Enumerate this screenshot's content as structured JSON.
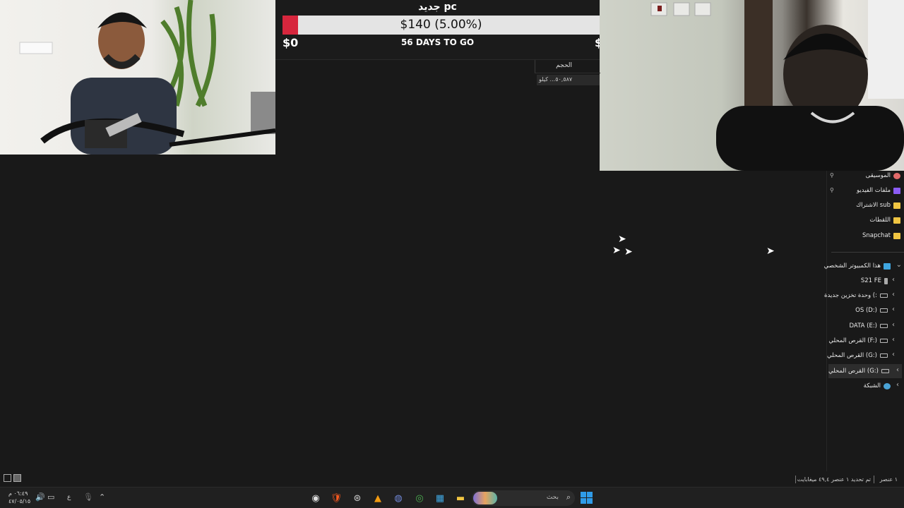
{
  "goal": {
    "title": "جديد pc",
    "amount_label": "$140 (5.00%)",
    "progress_percent": 5,
    "min_label": "$0",
    "days_label": "56 DAYS TO GO",
    "max_label": "$",
    "fill_color": "#d7263d"
  },
  "explorer": {
    "column_header": "الحجم",
    "size_cell": "٥٠,٥٨٧... كيلو",
    "nav": {
      "quick_access": [
        {
          "label": "الموسيقى",
          "icon": "music-icon"
        },
        {
          "label": "ملفات الفيديو",
          "icon": "video-icon"
        },
        {
          "label": "الاشتراك sub",
          "icon": "folder-icon"
        },
        {
          "label": "اللقطات",
          "icon": "folder-icon"
        },
        {
          "label": "Snapchat",
          "icon": "folder-icon"
        }
      ],
      "this_pc": "هذا الكمبيوتر الشخصي",
      "drives": [
        {
          "label": "S21 FE",
          "icon": "phone-icon"
        },
        {
          "label": "وحدة تخزين جديدة (:",
          "icon": "drive-icon"
        },
        {
          "label": "OS (D:)",
          "icon": "drive-icon"
        },
        {
          "label": "DATA (E:)",
          "icon": "drive-icon"
        },
        {
          "label": "القرص المحلي (F:)",
          "icon": "drive-icon"
        },
        {
          "label": "القرص المحلي (G:)",
          "icon": "drive-icon"
        },
        {
          "label": "القرص المحلي (G:)",
          "icon": "drive-icon",
          "selected": true
        }
      ],
      "network": "الشبكة"
    },
    "status": {
      "items_count": "١ عنصر",
      "selection": "تم تحديد ١ عنصر ٤٩,٤ ميغابايت"
    }
  },
  "taskbar": {
    "search_placeholder": "بحث",
    "clock_time": "٠٦:٤٩ م",
    "clock_date": "٤٧/٠٥/١٥",
    "language": "ع"
  }
}
